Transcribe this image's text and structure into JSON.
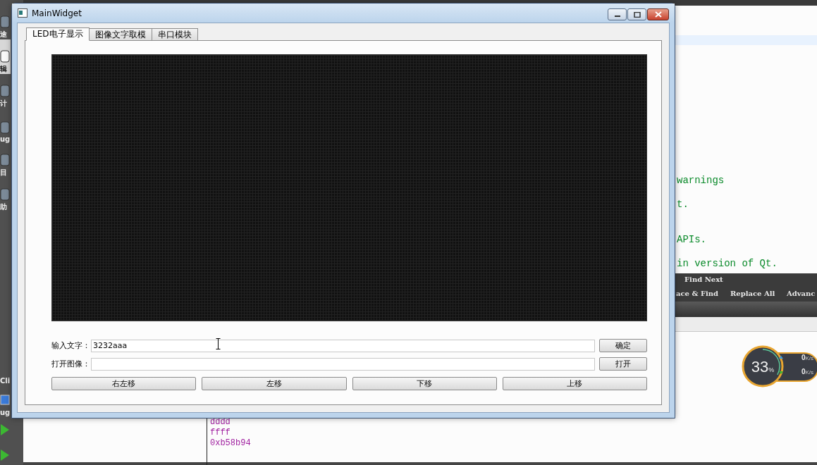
{
  "ide": {
    "sidebar": [
      {
        "label": "途"
      },
      {
        "label": "辑",
        "selected": true
      },
      {
        "label": "计",
        "selected": false
      },
      {
        "label": "ug",
        "selected": false
      },
      {
        "label": "目",
        "selected": false
      },
      {
        "label": "助",
        "selected": false
      }
    ],
    "sidebar_lower": [
      {
        "label": "Cli"
      },
      {
        "label": "ug"
      }
    ],
    "code_lines": [
      "warnings",
      "t.",
      "APIs.",
      "in version of Qt."
    ],
    "find_bar": {
      "row_1": [
        "Find Next"
      ],
      "row_2": [
        "ace & Find",
        "Replace All",
        "Advanc"
      ]
    },
    "output_lines": [
      "dddd",
      "ffff",
      "0xb58b94"
    ]
  },
  "window": {
    "title": "MainWidget",
    "tabs": [
      {
        "label": "LED电子显示",
        "selected": true
      },
      {
        "label": "图像文字取模",
        "selected": false
      },
      {
        "label": "串口模块",
        "selected": false
      }
    ],
    "text_input": {
      "label": "输入文字：",
      "value": "3232aaa"
    },
    "confirm_button": "确定",
    "image_input": {
      "label": "打开图像："
    },
    "open_button": "打开",
    "move_buttons": [
      "右左移",
      "左移",
      "下移",
      "上移"
    ]
  },
  "net_meter": {
    "percent": "33",
    "unit": "%",
    "level": 0.33,
    "upload": "0",
    "upload_unit": "K/s",
    "download": "0",
    "download_unit": "K/s"
  }
}
